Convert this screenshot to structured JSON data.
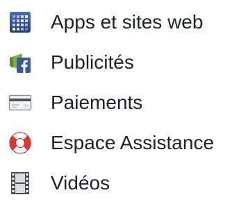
{
  "menu": {
    "items": [
      {
        "label": "Apps et sites web",
        "icon": "apps-grid-icon"
      },
      {
        "label": "Publicités",
        "icon": "facebook-ad-icon"
      },
      {
        "label": "Paiements",
        "icon": "credit-card-icon"
      },
      {
        "label": "Espace Assistance",
        "icon": "lifebuoy-icon"
      },
      {
        "label": "Vidéos",
        "icon": "film-strip-icon"
      }
    ]
  },
  "colors": {
    "text": "#1d2129",
    "apps_icon_blue": "#2d4a8a",
    "facebook_blue": "#3b5998",
    "lifebuoy_red": "#e0382f"
  }
}
